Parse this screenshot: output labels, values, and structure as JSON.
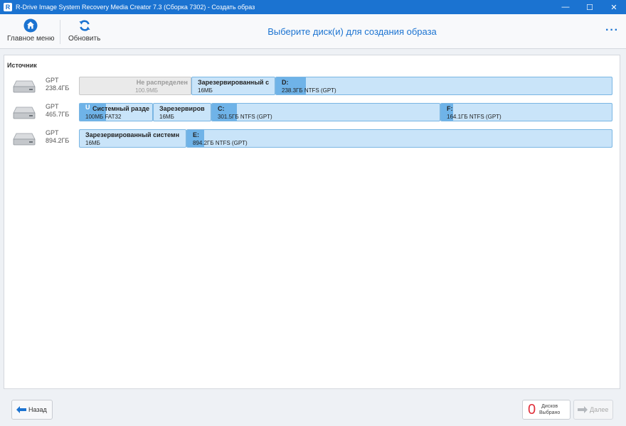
{
  "window": {
    "title": "R-Drive Image System Recovery Media Creator 7.3 (Сборка 7302) - Создать образ",
    "app_icon_letter": "R",
    "controls": {
      "minimize": "—",
      "maximize": "☐",
      "close": "✕"
    }
  },
  "toolbar": {
    "home_label": "Главное меню",
    "refresh_label": "Обновить",
    "page_title": "Выберите диск(и) для создания образа",
    "more_label": "···"
  },
  "source": {
    "label": "Источник",
    "disks": [
      {
        "type": "GPT",
        "size": "238.4ГБ",
        "partitions": [
          {
            "name": "Не распределен",
            "desc": "100.9МБ",
            "unallocated": true,
            "used_fraction": 0
          },
          {
            "name": "Зарезервированный с",
            "desc": "16МБ",
            "unallocated": false,
            "used_fraction": 0
          },
          {
            "name": "D:",
            "desc": "238.3ГБ NTFS (GPT)",
            "unallocated": false,
            "used_fraction": 0.09
          }
        ]
      },
      {
        "type": "GPT",
        "size": "465.7ГБ",
        "partitions": [
          {
            "marker": "U",
            "name": "Системный разде",
            "desc": "100МБ FAT32",
            "unallocated": false,
            "used_fraction": 0.36
          },
          {
            "name": "Зарезервиров",
            "desc": "16МБ",
            "unallocated": false,
            "used_fraction": 0
          },
          {
            "name": "C:",
            "desc": "301.5ГБ NTFS (GPT)",
            "unallocated": false,
            "used_fraction": 0.11
          },
          {
            "name": "F:",
            "desc": "164.1ГБ NTFS (GPT)",
            "unallocated": false,
            "used_fraction": 0.07
          }
        ]
      },
      {
        "type": "GPT",
        "size": "894.2ГБ",
        "partitions": [
          {
            "name": "Зарезервированный системн",
            "desc": "16МБ",
            "unallocated": false,
            "used_fraction": 0
          },
          {
            "name": "E:",
            "desc": "894.2ГБ NTFS (GPT)",
            "unallocated": false,
            "used_fraction": 0.04
          }
        ]
      }
    ]
  },
  "footer": {
    "back_label": "Назад",
    "selected_count": "0",
    "selected_label_line1": "Дисков",
    "selected_label_line2": "Выбрано",
    "next_label": "Далее"
  },
  "colors": {
    "accent": "#1b73d1",
    "partition_fill": "#c9e4f9",
    "partition_used": "#6fb3e8",
    "count_red": "#e0303b"
  }
}
